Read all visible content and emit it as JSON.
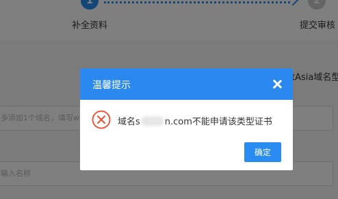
{
  "steps": {
    "step1": {
      "number": "1",
      "label": "补全资料"
    },
    "step2": {
      "number": "2",
      "label": "提交审核"
    }
  },
  "background": {
    "right_text": "tAsia域名型",
    "input1_placeholder": "多添加1个域名，填写w",
    "input2_placeholder": "输入名称"
  },
  "dialog": {
    "title": "温馨提示",
    "message_prefix": "域名s",
    "message_suffix": "n.com不能申请该类型证书",
    "confirm_label": "确定",
    "icons": {
      "close": "close-icon",
      "error": "error-circle-icon"
    },
    "colors": {
      "header": "#2b88ef",
      "button": "#2a8cf0",
      "error": "#e8573b"
    }
  }
}
